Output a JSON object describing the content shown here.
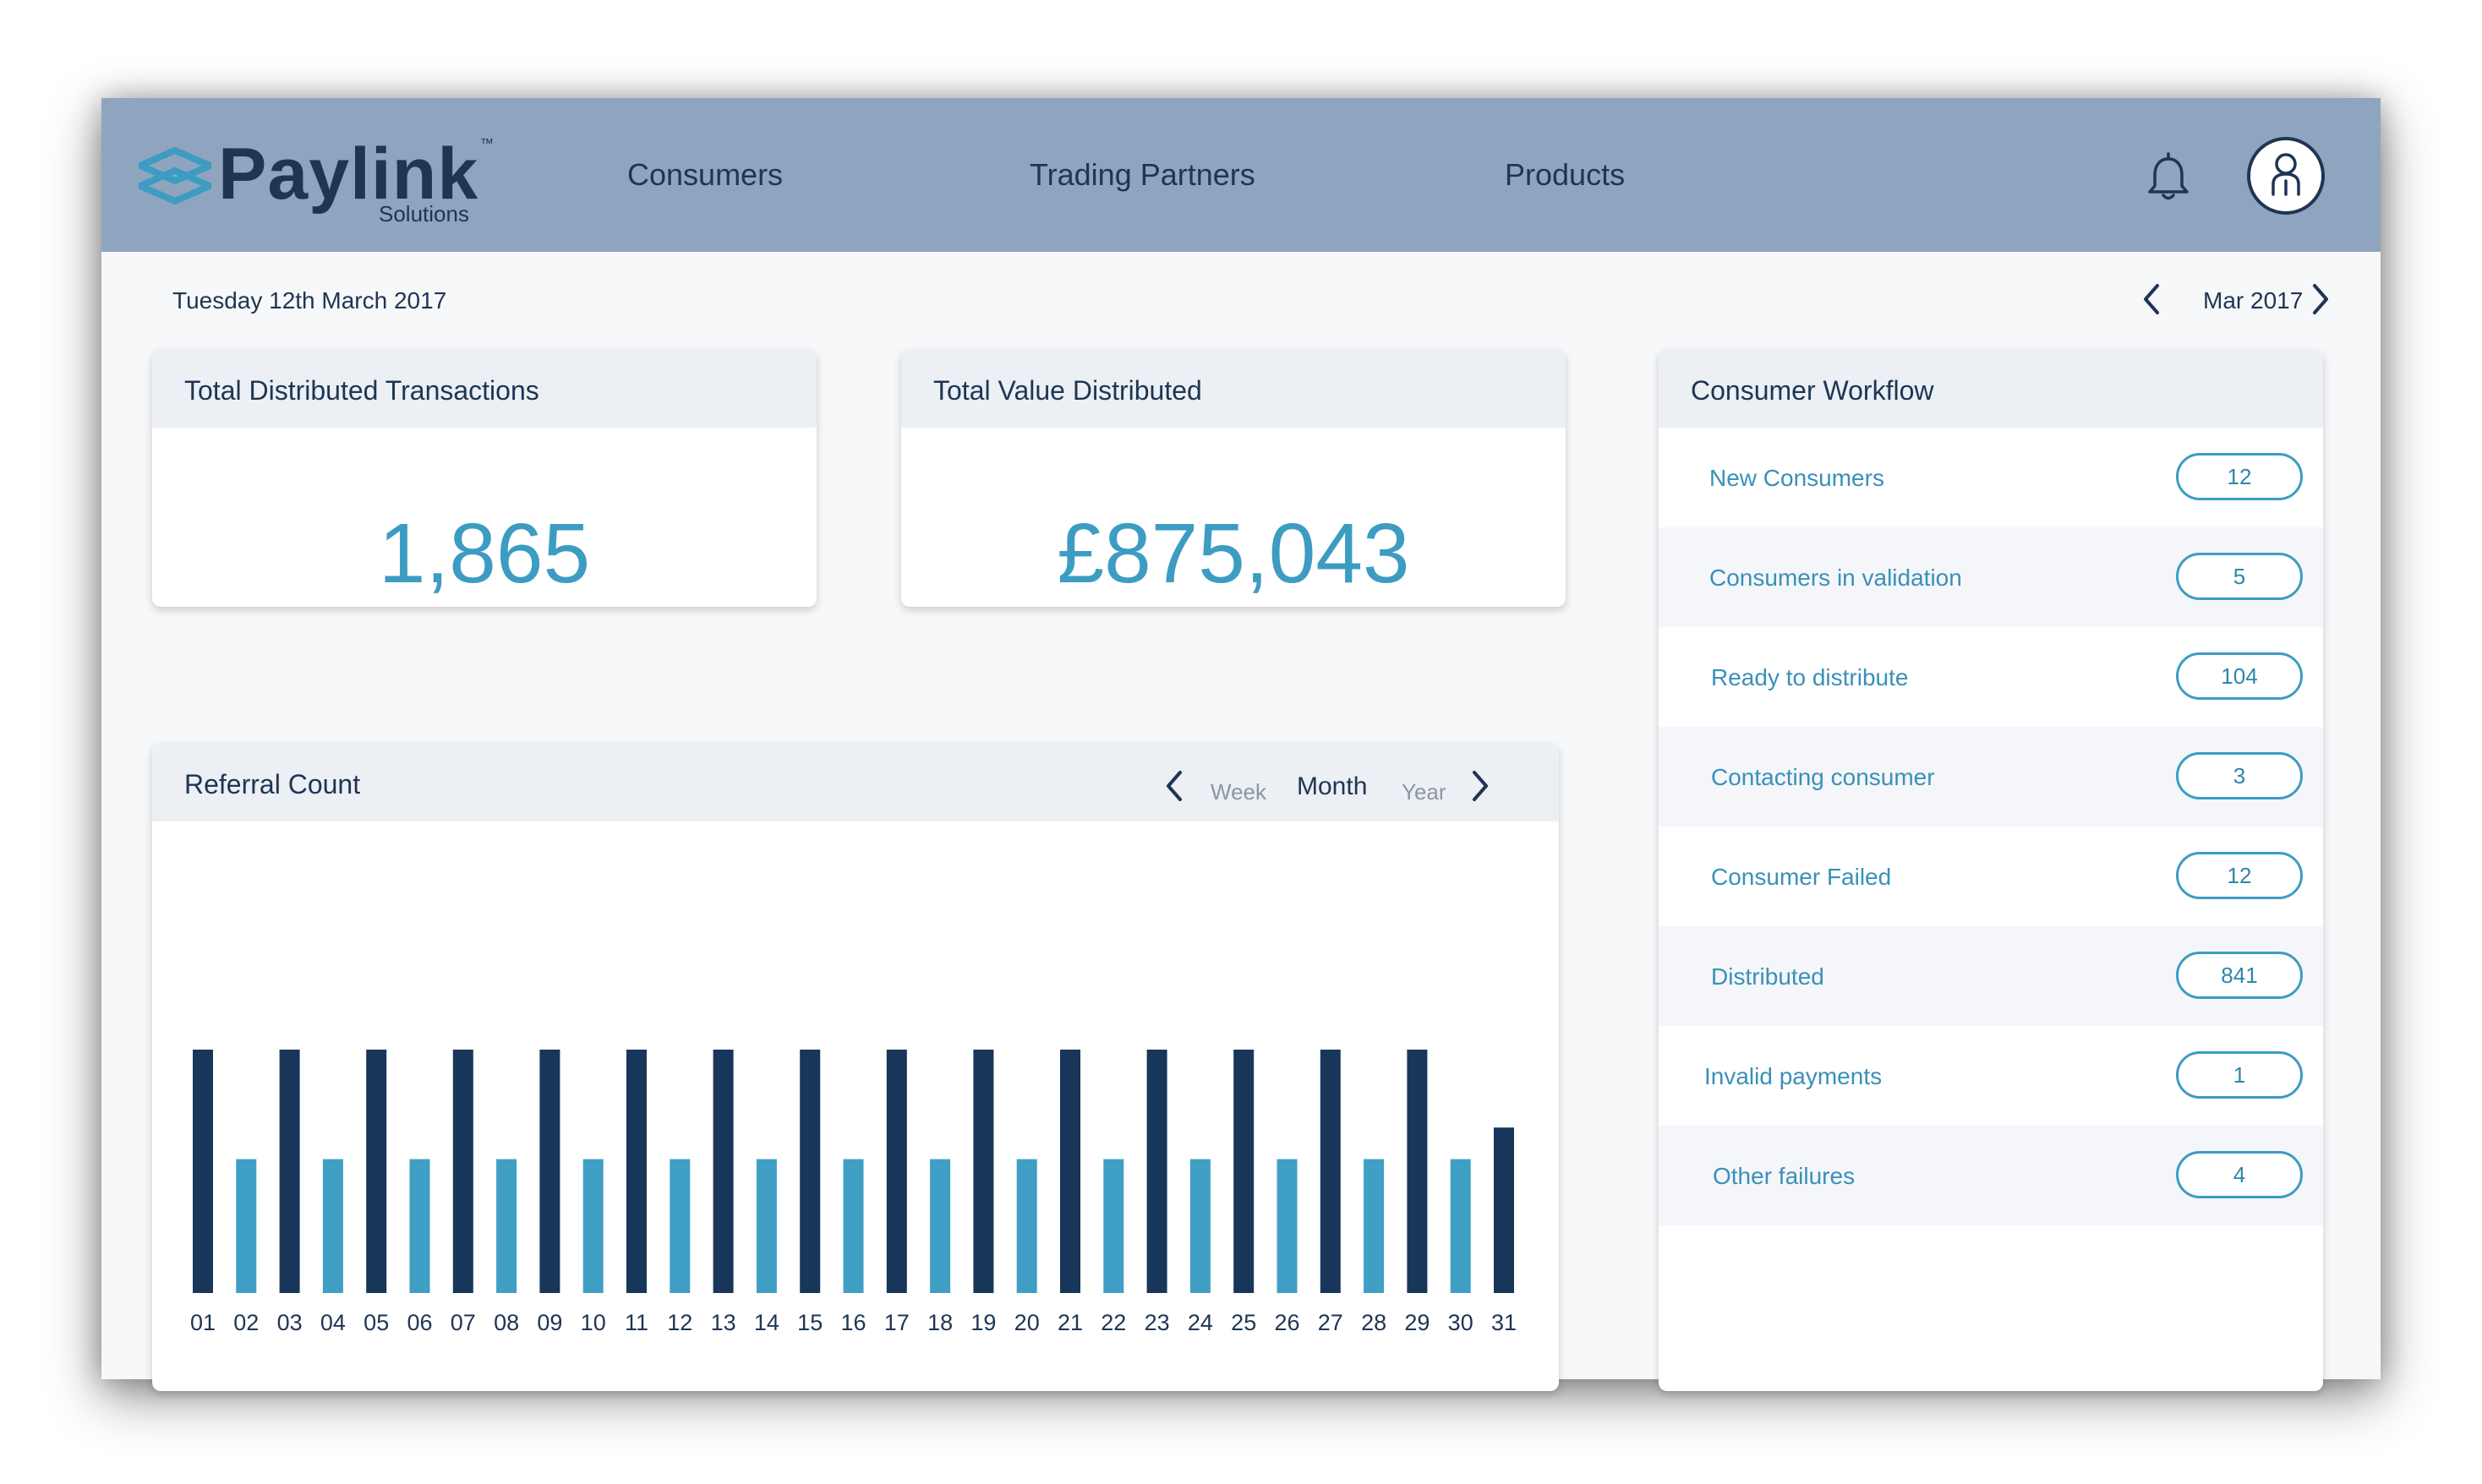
{
  "brand": {
    "name": "Paylink",
    "tm": "™",
    "subtitle": "Solutions"
  },
  "nav": {
    "items": [
      "Consumers",
      "Trading Partners",
      "Products"
    ]
  },
  "icons": {
    "bell": "bell-icon",
    "avatar": "user-avatar-icon",
    "prev": "chevron-left-icon",
    "next": "chevron-right-icon"
  },
  "date": {
    "today": "Tuesday 12th March 2017",
    "period": "Mar 2017"
  },
  "stats": {
    "transactions": {
      "title": "Total Distributed Transactions",
      "value": "1,865"
    },
    "value": {
      "title": "Total Value Distributed",
      "value": "£875,043"
    }
  },
  "referral": {
    "title": "Referral Count",
    "ranges": [
      "Week",
      "Month",
      "Year"
    ],
    "active_range": "Month"
  },
  "workflow": {
    "title": "Consumer Workflow",
    "items": [
      {
        "label": "New Consumers",
        "count": "12"
      },
      {
        "label": "Consumers in validation",
        "count": "5"
      },
      {
        "label": "Ready to distribute",
        "count": "104"
      },
      {
        "label": "Contacting consumer",
        "count": "3"
      },
      {
        "label": "Consumer Failed",
        "count": "12"
      },
      {
        "label": "Distributed",
        "count": "841"
      },
      {
        "label": "Invalid payments",
        "count": "1"
      },
      {
        "label": "Other failures",
        "count": "4"
      }
    ]
  },
  "colors": {
    "header": "#8fa5bf",
    "accent": "#3d9cc2",
    "dark_bar": "#17365a",
    "light_bar": "#3f9fc4"
  },
  "chart_data": {
    "type": "bar",
    "categories": [
      "01",
      "02",
      "03",
      "04",
      "05",
      "06",
      "07",
      "08",
      "09",
      "10",
      "11",
      "12",
      "13",
      "14",
      "15",
      "16",
      "17",
      "18",
      "19",
      "20",
      "21",
      "22",
      "23",
      "24",
      "25",
      "26",
      "27",
      "28",
      "29",
      "30",
      "31"
    ],
    "values": [
      100,
      55,
      100,
      55,
      100,
      55,
      100,
      55,
      100,
      55,
      100,
      55,
      100,
      55,
      100,
      55,
      100,
      55,
      100,
      55,
      100,
      55,
      100,
      55,
      100,
      55,
      100,
      55,
      100,
      55,
      68
    ],
    "ylim": [
      0,
      100
    ],
    "grid": false,
    "title": "Referral Count",
    "xlabel": "",
    "ylabel": ""
  }
}
